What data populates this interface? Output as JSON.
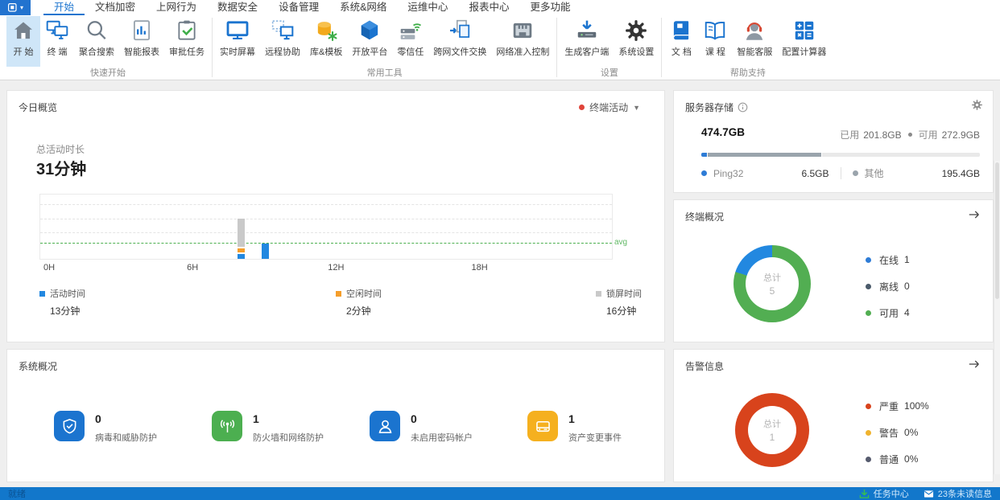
{
  "app": {
    "accent_color": "#1b74cf",
    "statusbar_color": "#1277cb"
  },
  "menubar": {
    "logo_icon": "app-logo-icon",
    "tabs": [
      {
        "label": "开始",
        "active": true
      },
      {
        "label": "文档加密"
      },
      {
        "label": "上网行为"
      },
      {
        "label": "数据安全"
      },
      {
        "label": "设备管理"
      },
      {
        "label": "系统&网络"
      },
      {
        "label": "运维中心"
      },
      {
        "label": "报表中心"
      },
      {
        "label": "更多功能"
      }
    ]
  },
  "ribbon": {
    "groups": [
      {
        "label": "快速开始",
        "buttons": [
          {
            "label": "开 始",
            "icon": "home-icon",
            "active": true
          },
          {
            "label": "终 端",
            "icon": "terminal-icon"
          },
          {
            "label": "聚合搜索",
            "icon": "search-icon"
          },
          {
            "label": "智能报表",
            "icon": "report-icon"
          },
          {
            "label": "审批任务",
            "icon": "approval-icon"
          }
        ]
      },
      {
        "label": "常用工具",
        "buttons": [
          {
            "label": "实时屏幕",
            "icon": "screen-icon"
          },
          {
            "label": "远程协助",
            "icon": "remote-icon"
          },
          {
            "label": "库&模板",
            "icon": "library-icon"
          },
          {
            "label": "开放平台",
            "icon": "platform-icon"
          },
          {
            "label": "零信任",
            "icon": "zerotrust-icon"
          },
          {
            "label": "跨网文件交换",
            "icon": "file-exchange-icon"
          },
          {
            "label": "网络准入控制",
            "icon": "nac-icon"
          }
        ]
      },
      {
        "label": "设置",
        "buttons": [
          {
            "label": "生成客户端",
            "icon": "client-gen-icon"
          },
          {
            "label": "系统设置",
            "icon": "gear-icon"
          }
        ]
      },
      {
        "label": "帮助支持",
        "buttons": [
          {
            "label": "文 档",
            "icon": "doc-icon"
          },
          {
            "label": "课 程",
            "icon": "course-icon"
          },
          {
            "label": "智能客服",
            "icon": "support-icon"
          },
          {
            "label": "配置计算器",
            "icon": "calculator-icon"
          }
        ]
      }
    ]
  },
  "overview_card": {
    "title": "今日概览",
    "filter_label": "终端活动",
    "metric_label": "总活动时长",
    "metric_value": "31分钟"
  },
  "storage_card": {
    "title": "服务器存储",
    "total": "474.7GB",
    "used_label": "已用",
    "used_value": "201.8GB",
    "free_label": "可用",
    "free_value": "272.9GB",
    "detail": [
      {
        "name": "Ping32",
        "value": "6.5GB",
        "dot_color": "#2e7cd6"
      },
      {
        "name": "其他",
        "value": "195.4GB",
        "dot_color": "#9aa4ac"
      }
    ]
  },
  "terminal_card": {
    "title": "终端概况"
  },
  "alert_card": {
    "title": "告警信息"
  },
  "system_card": {
    "title": "系统概况",
    "items": [
      {
        "value": "0",
        "label": "病毒和威胁防护",
        "icon": "shield-icon",
        "bg": "#1b74cf"
      },
      {
        "value": "1",
        "label": "防火墙和网络防护",
        "icon": "firewall-icon",
        "bg": "#4caf50"
      },
      {
        "value": "0",
        "label": "未启用密码帐户",
        "icon": "user-icon",
        "bg": "#1b74cf"
      },
      {
        "value": "1",
        "label": "资产变更事件",
        "icon": "asset-icon",
        "bg": "#f5b01f"
      }
    ]
  },
  "statusbar": {
    "ready": "就绪",
    "task_center": "任务中心",
    "unread": "23条未读信息"
  },
  "chart_data": [
    {
      "id": "activity_timeline",
      "type": "bar",
      "title": "终端活动",
      "x_unit": "hour",
      "x_range": [
        0,
        24
      ],
      "x_ticks": [
        {
          "label": "0H",
          "hour": 0
        },
        {
          "label": "6H",
          "hour": 6
        },
        {
          "label": "12H",
          "hour": 12
        },
        {
          "label": "18H",
          "hour": 18
        }
      ],
      "y_unit": "minutes",
      "ylim": [
        0,
        36
      ],
      "grid": "dashed-horizontal",
      "avg": {
        "value": 8.4,
        "label": "avg",
        "color": "#4caf50"
      },
      "series": [
        {
          "name": "活动时间",
          "total_label": "13分钟",
          "color": "#2288e0"
        },
        {
          "name": "空闲时间",
          "total_label": "2分钟",
          "color": "#f59e2b"
        },
        {
          "name": "锁屏时间",
          "total_label": "16分钟",
          "color": "#c9c9c9"
        }
      ],
      "bars": [
        {
          "hour": 8,
          "values": [
            3,
            3,
            16
          ]
        },
        {
          "hour": 9,
          "values": [
            9,
            0,
            0
          ]
        }
      ]
    },
    {
      "id": "storage_usage",
      "type": "bar",
      "total_gb": 474.7,
      "used_gb": 201.8,
      "free_gb": 272.9,
      "segments": [
        {
          "name": "Ping32",
          "gb": 6.5,
          "fraction": 0.02,
          "color": "#2e7cd6"
        },
        {
          "name": "其他",
          "gb": 195.4,
          "fraction": 0.41,
          "color": "#9aa4ac"
        },
        {
          "name": "空闲",
          "gb": 272.9,
          "fraction": 0.57,
          "color": "#e9e9e9"
        }
      ]
    },
    {
      "id": "terminal_donut",
      "type": "pie",
      "center_label": "总计",
      "center_value": "5",
      "slices": [
        {
          "name": "可用",
          "value": 4,
          "fraction": 0.8,
          "color": "#52ae52"
        },
        {
          "name": "在线",
          "value": 1,
          "fraction": 0.2,
          "color": "#2288e0"
        }
      ],
      "legend": [
        {
          "label": "在线",
          "value": "1",
          "color": "#2e7cd6"
        },
        {
          "label": "离线",
          "value": "0",
          "color": "#4a5a6a"
        },
        {
          "label": "可用",
          "value": "4",
          "color": "#52ae52"
        }
      ],
      "legend_position": "right"
    },
    {
      "id": "alert_donut",
      "type": "pie",
      "center_label": "总计",
      "center_value": "1",
      "slices": [
        {
          "name": "严重",
          "value": 1,
          "fraction": 1,
          "color": "#d8431c"
        }
      ],
      "legend": [
        {
          "label": "严重",
          "value": "100%",
          "color": "#d8431c"
        },
        {
          "label": "警告",
          "value": "0%",
          "color": "#f0b32e"
        },
        {
          "label": "普通",
          "value": "0%",
          "color": "#565b6e"
        }
      ],
      "legend_position": "right"
    }
  ]
}
